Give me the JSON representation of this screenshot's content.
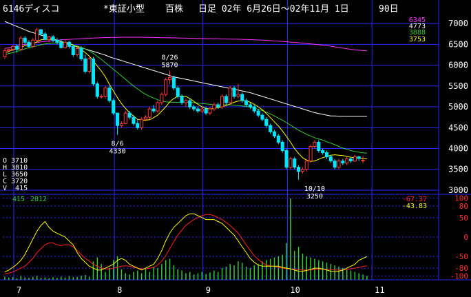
{
  "header": {
    "code_name": "6146ディスコ",
    "market": "*東証小型",
    "unit": "百株",
    "period": "日足 02年 6月26日～02年11月 1日",
    "days": "90日"
  },
  "ohlc": {
    "o": "O 3710",
    "h": "H 3810",
    "l": "L 3650",
    "c": "C 3720",
    "v": "V  415"
  },
  "volume_readout": {
    "v1": "415",
    "v2": "2812"
  },
  "ma_readout": {
    "ma_long": "6345",
    "ma_mid": "4773",
    "ma_short": "3888",
    "ma_fast": "3753"
  },
  "osc_readout": {
    "a": "-67.37",
    "b": "-43.83"
  },
  "colors": {
    "background": "#000000",
    "grid": "#2a2aff",
    "up_candle": "#ff3b3b",
    "down_candle": "#00e5ff",
    "ma_fast": "#ffff00",
    "ma_mid": "#33cc33",
    "ma_long": "#ffffff",
    "ma_longest": "#ff33ff",
    "volume": "#33cc33",
    "osc_fast": "#ffff00",
    "osc_slow": "#ff2020",
    "axis_text": "#ffffff",
    "osc_axis_text": "#ff3030"
  },
  "chart_data": {
    "type": "candlestick",
    "price_axis": {
      "ylim": [
        2900,
        7200
      ],
      "ticks": [
        7000,
        6500,
        6000,
        5500,
        5000,
        4500,
        4000,
        3500,
        3000
      ]
    },
    "osc_axis": {
      "ylim": [
        -110,
        110
      ],
      "ticks": [
        100,
        80,
        50,
        0,
        -50,
        -80,
        -100
      ]
    },
    "month_labels": [
      "7",
      "8",
      "9",
      "10",
      "11"
    ],
    "month_start_index": [
      0,
      25,
      47,
      68,
      89
    ],
    "annotations": [
      {
        "date_label": "8/6",
        "value": "4330",
        "index": 28,
        "price": 4330,
        "position": "below"
      },
      {
        "date_label": "8/26",
        "value": "5870",
        "index": 41,
        "price": 5870,
        "position": "above"
      },
      {
        "date_label": "10/10",
        "value": "3250",
        "index": 77,
        "price": 3250,
        "position": "below"
      }
    ],
    "candles": [
      [
        6200,
        6400,
        6150,
        6350
      ],
      [
        6350,
        6420,
        6300,
        6380
      ],
      [
        6380,
        6480,
        6340,
        6450
      ],
      [
        6450,
        6500,
        6300,
        6380
      ],
      [
        6380,
        6700,
        6350,
        6650
      ],
      [
        6650,
        6700,
        6500,
        6550
      ],
      [
        6550,
        6600,
        6400,
        6450
      ],
      [
        6450,
        6650,
        6420,
        6600
      ],
      [
        6600,
        6900,
        6580,
        6850
      ],
      [
        6850,
        6870,
        6700,
        6750
      ],
      [
        6750,
        6800,
        6600,
        6620
      ],
      [
        6620,
        6700,
        6550,
        6680
      ],
      [
        6680,
        6720,
        6550,
        6600
      ],
      [
        6600,
        6650,
        6500,
        6550
      ],
      [
        6550,
        6620,
        6400,
        6420
      ],
      [
        6420,
        6600,
        6400,
        6550
      ],
      [
        6550,
        6580,
        6400,
        6450
      ],
      [
        6450,
        6500,
        6200,
        6250
      ],
      [
        6250,
        6450,
        6200,
        6400
      ],
      [
        6400,
        6450,
        6100,
        6150
      ],
      [
        6150,
        6250,
        5800,
        5850
      ],
      [
        5850,
        6200,
        5800,
        6150
      ],
      [
        6150,
        6200,
        5500,
        5550
      ],
      [
        5550,
        5600,
        5200,
        5250
      ],
      [
        5250,
        5300,
        5200,
        5250
      ],
      [
        5250,
        5500,
        5200,
        5450
      ],
      [
        5450,
        5500,
        5100,
        5150
      ],
      [
        5150,
        5200,
        4800,
        4850
      ],
      [
        4850,
        4850,
        4330,
        4550
      ],
      [
        4550,
        4650,
        4500,
        4600
      ],
      [
        4600,
        4900,
        4580,
        4850
      ],
      [
        4850,
        4900,
        4700,
        4750
      ],
      [
        4750,
        4800,
        4550,
        4600
      ],
      [
        4600,
        4700,
        4450,
        4500
      ],
      [
        4500,
        4750,
        4450,
        4700
      ],
      [
        4700,
        4800,
        4650,
        4750
      ],
      [
        4750,
        5000,
        4700,
        4950
      ],
      [
        4950,
        5050,
        4850,
        4900
      ],
      [
        4900,
        5150,
        4850,
        5100
      ],
      [
        5100,
        5350,
        5050,
        5300
      ],
      [
        5300,
        5700,
        5250,
        5650
      ],
      [
        5650,
        5870,
        5550,
        5700
      ],
      [
        5700,
        5750,
        5400,
        5450
      ],
      [
        5450,
        5500,
        5200,
        5250
      ],
      [
        5250,
        5300,
        5050,
        5100
      ],
      [
        5100,
        5200,
        5000,
        5150
      ],
      [
        5150,
        5200,
        4950,
        5000
      ],
      [
        5000,
        5050,
        4900,
        4950
      ],
      [
        4950,
        5000,
        4850,
        4900
      ],
      [
        4900,
        5000,
        4850,
        4950
      ],
      [
        4950,
        5000,
        4800,
        4850
      ],
      [
        4850,
        5000,
        4800,
        4950
      ],
      [
        4950,
        5100,
        4900,
        5050
      ],
      [
        5050,
        5100,
        4950,
        5000
      ],
      [
        5000,
        5300,
        4950,
        5250
      ],
      [
        5250,
        5300,
        5050,
        5100
      ],
      [
        5100,
        5500,
        5050,
        5450
      ],
      [
        5450,
        5500,
        5200,
        5250
      ],
      [
        5250,
        5550,
        5200,
        5300
      ],
      [
        5300,
        5350,
        5100,
        5150
      ],
      [
        5150,
        5200,
        5000,
        5050
      ],
      [
        5050,
        5100,
        4950,
        5000
      ],
      [
        5000,
        5050,
        4850,
        4900
      ],
      [
        4900,
        4950,
        4750,
        4800
      ],
      [
        4800,
        4850,
        4650,
        4700
      ],
      [
        4700,
        4750,
        4500,
        4550
      ],
      [
        4550,
        4600,
        4350,
        4400
      ],
      [
        4400,
        4450,
        4250,
        4300
      ],
      [
        4300,
        4350,
        4100,
        4150
      ],
      [
        4150,
        4200,
        3900,
        3950
      ],
      [
        3950,
        4000,
        3500,
        3550
      ],
      [
        3550,
        3800,
        3500,
        3750
      ],
      [
        3750,
        3800,
        3500,
        3550
      ],
      [
        3550,
        3600,
        3250,
        3450
      ],
      [
        3450,
        3550,
        3400,
        3500
      ],
      [
        3500,
        3750,
        3450,
        3700
      ],
      [
        3700,
        4100,
        3650,
        4050
      ],
      [
        4050,
        4200,
        4000,
        4150
      ],
      [
        4150,
        4200,
        3900,
        3950
      ],
      [
        3950,
        4000,
        3850,
        3900
      ],
      [
        3900,
        3950,
        3750,
        3800
      ],
      [
        3800,
        3850,
        3650,
        3700
      ],
      [
        3700,
        3750,
        3500,
        3550
      ],
      [
        3550,
        3750,
        3500,
        3700
      ],
      [
        3700,
        3750,
        3600,
        3650
      ],
      [
        3650,
        3800,
        3600,
        3750
      ],
      [
        3750,
        3800,
        3650,
        3700
      ],
      [
        3700,
        3850,
        3680,
        3800
      ],
      [
        3800,
        3820,
        3700,
        3760
      ],
      [
        3710,
        3810,
        3650,
        3720
      ]
    ],
    "ma_fast": [
      6300,
      6330,
      6370,
      6390,
      6420,
      6470,
      6500,
      6510,
      6560,
      6610,
      6620,
      6620,
      6610,
      6600,
      6560,
      6540,
      6530,
      6480,
      6430,
      6380,
      6300,
      6220,
      6100,
      5980,
      5860,
      5720,
      5540,
      5380,
      5220,
      5080,
      4960,
      4860,
      4780,
      4700,
      4680,
      4680,
      4690,
      4740,
      4800,
      4900,
      5000,
      5120,
      5200,
      5250,
      5260,
      5250,
      5200,
      5130,
      5060,
      5000,
      4960,
      4950,
      4960,
      4980,
      5000,
      5030,
      5070,
      5110,
      5140,
      5150,
      5140,
      5110,
      5060,
      5000,
      4930,
      4840,
      4740,
      4640,
      4540,
      4420,
      4290,
      4150,
      4000,
      3880,
      3780,
      3720,
      3690,
      3700,
      3740,
      3780,
      3810,
      3840,
      3850,
      3840,
      3830,
      3810,
      3790,
      3780,
      3770,
      3760,
      3753
    ],
    "ma_mid": [
      6250,
      6280,
      6300,
      6330,
      6360,
      6390,
      6420,
      6440,
      6460,
      6490,
      6510,
      6520,
      6530,
      6530,
      6530,
      6520,
      6500,
      6480,
      6460,
      6430,
      6390,
      6340,
      6280,
      6210,
      6140,
      6060,
      5980,
      5900,
      5820,
      5740,
      5660,
      5580,
      5500,
      5430,
      5360,
      5300,
      5250,
      5210,
      5170,
      5140,
      5120,
      5110,
      5110,
      5110,
      5110,
      5110,
      5110,
      5100,
      5090,
      5080,
      5070,
      5060,
      5050,
      5050,
      5050,
      5050,
      5050,
      5040,
      5030,
      5020,
      5010,
      4990,
      4970,
      4940,
      4910,
      4870,
      4830,
      4780,
      4730,
      4680,
      4620,
      4560,
      4500,
      4440,
      4390,
      4340,
      4300,
      4260,
      4230,
      4200,
      4160,
      4130,
      4090,
      4050,
      4010,
      3980,
      3950,
      3930,
      3910,
      3895,
      3888
    ],
    "ma_long": [
      7050,
      7010,
      6970,
      6930,
      6890,
      6850,
      6810,
      6780,
      6750,
      6720,
      6690,
      6660,
      6630,
      6600,
      6570,
      6540,
      6510,
      6480,
      6450,
      6420,
      6390,
      6360,
      6330,
      6300,
      6270,
      6240,
      6200,
      6170,
      6140,
      6110,
      6080,
      6050,
      6020,
      5990,
      5960,
      5930,
      5900,
      5870,
      5840,
      5810,
      5780,
      5750,
      5720,
      5700,
      5680,
      5660,
      5640,
      5620,
      5600,
      5580,
      5560,
      5540,
      5520,
      5500,
      5480,
      5460,
      5440,
      5420,
      5400,
      5380,
      5360,
      5340,
      5310,
      5280,
      5250,
      5220,
      5190,
      5160,
      5130,
      5100,
      5070,
      5040,
      5010,
      4980,
      4950,
      4920,
      4890,
      4860,
      4840,
      4820,
      4800,
      4780,
      4780,
      4775,
      4775,
      4774,
      4774,
      4773,
      4773,
      4773,
      4773
    ],
    "ma_longest": [
      6400,
      6420,
      6440,
      6460,
      6480,
      6500,
      6515,
      6530,
      6545,
      6560,
      6570,
      6580,
      6590,
      6600,
      6610,
      6615,
      6620,
      6625,
      6630,
      6635,
      6640,
      6645,
      6650,
      6655,
      6660,
      6662,
      6664,
      6666,
      6668,
      6670,
      6670,
      6670,
      6670,
      6670,
      6670,
      6668,
      6666,
      6664,
      6662,
      6660,
      6658,
      6656,
      6654,
      6652,
      6650,
      6648,
      6646,
      6644,
      6642,
      6640,
      6638,
      6636,
      6634,
      6632,
      6630,
      6628,
      6626,
      6624,
      6622,
      6620,
      6616,
      6612,
      6608,
      6604,
      6600,
      6594,
      6588,
      6582,
      6576,
      6570,
      6562,
      6554,
      6546,
      6538,
      6530,
      6520,
      6510,
      6500,
      6490,
      6480,
      6470,
      6455,
      6440,
      6425,
      6410,
      6395,
      6380,
      6370,
      6360,
      6350,
      6345
    ],
    "volume": [
      12,
      8,
      10,
      6,
      14,
      9,
      7,
      11,
      15,
      8,
      9,
      6,
      10,
      7,
      12,
      9,
      14,
      10,
      11,
      16,
      18,
      12,
      70,
      85,
      60,
      30,
      45,
      75,
      90,
      40,
      25,
      20,
      30,
      35,
      25,
      40,
      30,
      50,
      45,
      60,
      75,
      80,
      55,
      40,
      35,
      25,
      30,
      20,
      25,
      30,
      22,
      28,
      35,
      30,
      45,
      50,
      60,
      55,
      70,
      65,
      50,
      45,
      55,
      60,
      70,
      75,
      80,
      85,
      90,
      95,
      140,
      310,
      110,
      125,
      100,
      90,
      85,
      80,
      75,
      70,
      65,
      60,
      55,
      50,
      45,
      40,
      35,
      30,
      25,
      20,
      15
    ],
    "osc_fast": [
      -90,
      -85,
      -78,
      -70,
      -60,
      -45,
      -25,
      -5,
      15,
      30,
      40,
      25,
      15,
      10,
      5,
      0,
      -10,
      -20,
      -40,
      -55,
      -65,
      -75,
      -80,
      -85,
      -85,
      -80,
      -75,
      -70,
      -60,
      -55,
      -60,
      -70,
      -75,
      -80,
      -85,
      -80,
      -75,
      -70,
      -55,
      -35,
      -10,
      10,
      25,
      35,
      45,
      55,
      60,
      60,
      55,
      50,
      45,
      45,
      45,
      40,
      35,
      25,
      15,
      5,
      -10,
      -25,
      -40,
      -55,
      -65,
      -72,
      -75,
      -75,
      -75,
      -75,
      -75,
      -78,
      -80,
      -82,
      -85,
      -88,
      -88,
      -86,
      -83,
      -80,
      -80,
      -82,
      -85,
      -88,
      -90,
      -88,
      -85,
      -80,
      -75,
      -70,
      -60,
      -55,
      -50
    ],
    "osc_slow": [
      -95,
      -93,
      -90,
      -85,
      -80,
      -75,
      -65,
      -55,
      -40,
      -30,
      -20,
      -15,
      -15,
      -20,
      -22,
      -20,
      -20,
      -25,
      -35,
      -45,
      -55,
      -62,
      -70,
      -75,
      -80,
      -82,
      -82,
      -80,
      -78,
      -75,
      -74,
      -75,
      -78,
      -80,
      -82,
      -82,
      -80,
      -78,
      -72,
      -62,
      -48,
      -30,
      -12,
      5,
      18,
      30,
      38,
      45,
      50,
      55,
      58,
      58,
      55,
      50,
      45,
      38,
      30,
      20,
      10,
      -5,
      -20,
      -35,
      -48,
      -58,
      -66,
      -72,
      -74,
      -76,
      -78,
      -80,
      -81,
      -82,
      -83,
      -84,
      -85,
      -85,
      -85,
      -84,
      -83,
      -83,
      -83,
      -84,
      -85,
      -85,
      -85,
      -84,
      -82,
      -80,
      -78,
      -76,
      -74
    ]
  }
}
